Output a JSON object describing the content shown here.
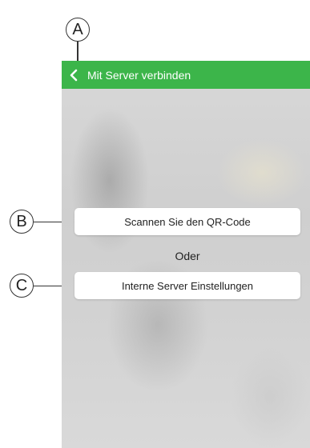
{
  "callouts": {
    "a": "A",
    "b": "B",
    "c": "C"
  },
  "header": {
    "back_icon": "chevron-left-icon",
    "title": "Mit Server verbinden",
    "color": "#3cb54a"
  },
  "main": {
    "scan_button_label": "Scannen Sie den QR-Code",
    "or_label": "Oder",
    "internal_settings_button_label": "Interne Server Einstellungen"
  }
}
